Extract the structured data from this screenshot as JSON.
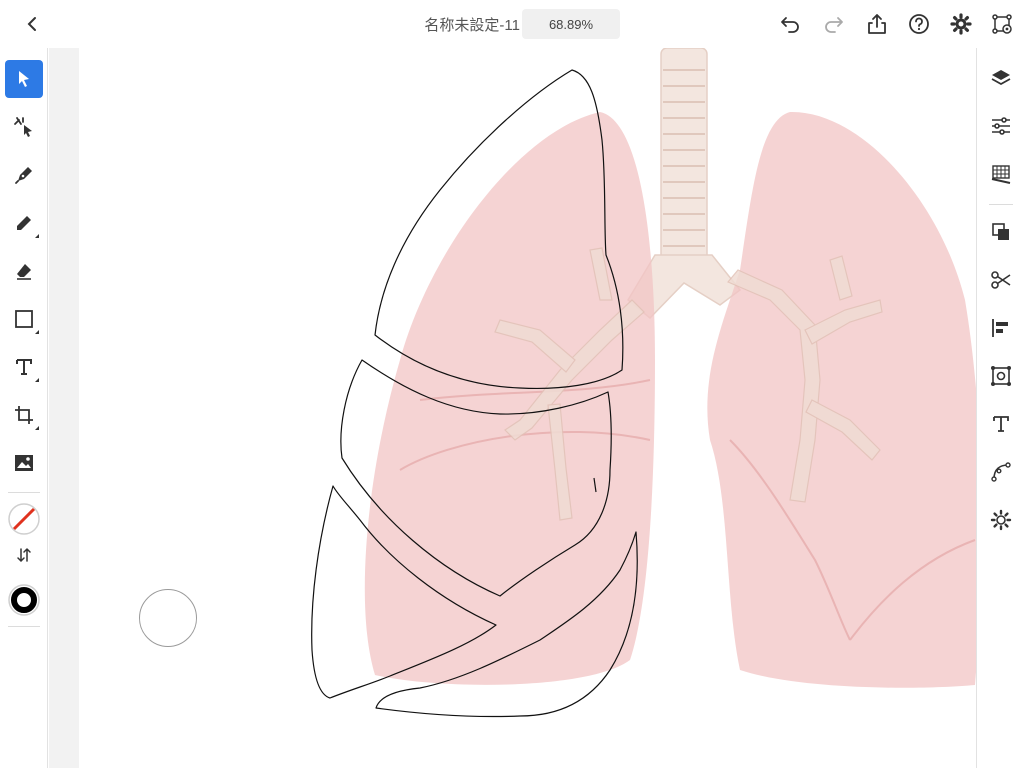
{
  "header": {
    "title": "名称未設定-11",
    "zoom": "68.89%"
  },
  "icons": {
    "back": "chevron-left-icon",
    "undo": "undo-icon",
    "redo": "redo-icon",
    "share": "share-icon",
    "help": "help-icon",
    "settings": "gear-icon",
    "cloud": "cloud-sync-icon"
  },
  "left_toolbar": {
    "tools": [
      "select-tool",
      "direct-select-tool",
      "pen-tool",
      "pencil-tool",
      "eraser-tool",
      "shape-tool",
      "type-tool",
      "crop-tool",
      "image-tool"
    ],
    "fill": "none",
    "stroke": "#000000"
  },
  "right_panel": {
    "items": [
      "layers",
      "properties",
      "grids",
      "arrange",
      "scissors",
      "align",
      "repeat-grid",
      "text-properties",
      "path",
      "settings"
    ]
  },
  "colors": {
    "accent": "#2d7ae5",
    "lung": "#f1c4c4",
    "trachea": "#f4e4dc"
  }
}
